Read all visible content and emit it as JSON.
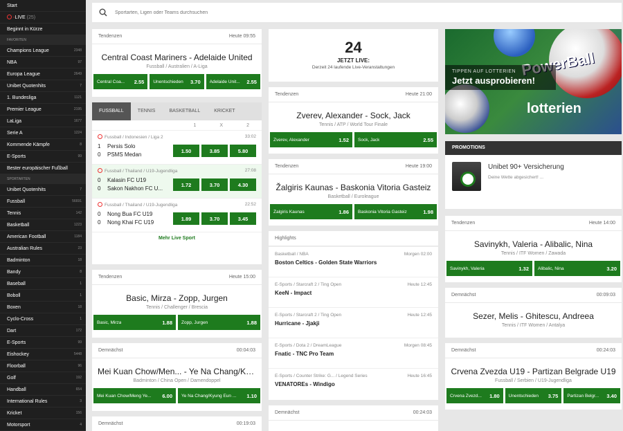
{
  "sidebar": {
    "top": [
      {
        "label": "Start"
      },
      {
        "label": "LIVE",
        "count": "(25)"
      },
      {
        "label": "Beginnt in Kürze"
      }
    ],
    "favoriten_title": "FAVORITEN",
    "favoriten": [
      {
        "label": "Champions League",
        "count": "2348"
      },
      {
        "label": "NBA",
        "count": "97"
      },
      {
        "label": "Europa League",
        "count": "2649"
      },
      {
        "label": "Unibet Quotenhits",
        "count": "7"
      },
      {
        "label": "1. Bundesliga",
        "count": "1121"
      },
      {
        "label": "Premier League",
        "count": "2195"
      },
      {
        "label": "LaLiga",
        "count": "1677"
      },
      {
        "label": "Serie A",
        "count": "1224"
      },
      {
        "label": "Kommende Kämpfe",
        "count": "8"
      },
      {
        "label": "E-Sports",
        "count": "99"
      },
      {
        "label": "Bester europäischer Fußball",
        "count": ""
      }
    ],
    "sportarten_title": "SPORTARTEN",
    "sportarten": [
      {
        "label": "Unibet Quotenhits",
        "count": "7"
      },
      {
        "label": "Fussball",
        "count": "56691"
      },
      {
        "label": "Tennis",
        "count": "142"
      },
      {
        "label": "Basketball",
        "count": "1223"
      },
      {
        "label": "American Football",
        "count": "1184"
      },
      {
        "label": "Australian Rules",
        "count": "23"
      },
      {
        "label": "Badminton",
        "count": "18"
      },
      {
        "label": "Bandy",
        "count": "8"
      },
      {
        "label": "Baseball",
        "count": "1"
      },
      {
        "label": "Boboll",
        "count": "1"
      },
      {
        "label": "Boxen",
        "count": "18"
      },
      {
        "label": "Cyclo-Cross",
        "count": "1"
      },
      {
        "label": "Dart",
        "count": "172"
      },
      {
        "label": "E-Sports",
        "count": "99"
      },
      {
        "label": "Eishockey",
        "count": "5448"
      },
      {
        "label": "Floorball",
        "count": "96"
      },
      {
        "label": "Golf",
        "count": "192"
      },
      {
        "label": "Handball",
        "count": "654"
      },
      {
        "label": "International Rules",
        "count": "3"
      },
      {
        "label": "Kricket",
        "count": "156"
      },
      {
        "label": "Motorsport",
        "count": "4"
      }
    ]
  },
  "search": {
    "placeholder": "Sportarten, Ligen oder Teams durchsuchen"
  },
  "col1": {
    "featured": {
      "header": "Tendenzen",
      "time": "Heute 09:55",
      "title": "Central Coast Mariners - Adelaide United",
      "sub": "Fussball / Australien / A-Liga",
      "odds": [
        {
          "label": "Central Coa...",
          "value": "2.55"
        },
        {
          "label": "Unentschieden",
          "value": "3.70"
        },
        {
          "label": "Adelaide Unit...",
          "value": "2.55"
        }
      ]
    },
    "live": {
      "tabs": [
        "FUSSBALL",
        "TENNIS",
        "BASKETBALL",
        "KRICKET"
      ],
      "cols": [
        "1",
        "X",
        "2"
      ],
      "items": [
        {
          "league": "Fussball / Indonesien / Liga 2",
          "time": "33:02",
          "s1": "1",
          "t1": "Persis Solo",
          "s2": "0",
          "t2": "PSMS Medan",
          "o": [
            "1.50",
            "3.85",
            "5.80"
          ]
        },
        {
          "league": "Fussball / Thailand / U19-Jugendliga",
          "time": "27:08",
          "s1": "0",
          "t1": "Kalasin FC U19",
          "s2": "0",
          "t2": "Sakon Nakhon FC U...",
          "o": [
            "1.72",
            "3.70",
            "4.30"
          ]
        },
        {
          "league": "Fussball / Thailand / U19-Jugendliga",
          "time": "22:52",
          "s1": "0",
          "t1": "Nong Bua FC U19",
          "s2": "0",
          "t2": "Nong Khai FC U19",
          "o": [
            "1.89",
            "3.70",
            "3.45"
          ]
        }
      ],
      "more": "Mehr Live Sport"
    },
    "m2": {
      "header": "Tendenzen",
      "time": "Heute 15:00",
      "title": "Basic, Mirza - Zopp, Jurgen",
      "sub": "Tennis / Challenger / Brescia",
      "odds": [
        {
          "label": "Basic, Mirza",
          "value": "1.88"
        },
        {
          "label": "Zopp, Jurgen",
          "value": "1.88"
        }
      ]
    },
    "m3": {
      "header": "Demnächst",
      "time": "00:04:03",
      "title": "Mei Kuan Chow/Men... - Ye Na Chang/Kyun...",
      "sub": "Badminton / China Open / Damendoppel",
      "odds": [
        {
          "label": "Mei Kuan Chow/Meng Ye...",
          "value": "6.00"
        },
        {
          "label": "Ye Na Chang/Kyung Eun ...",
          "value": "1.10"
        }
      ]
    },
    "m4": {
      "header": "Demnächst",
      "time": "00:19:03"
    }
  },
  "col2": {
    "live": {
      "num": "24",
      "label": "JETZT LIVE:",
      "sub": "Derzeit 24 laufende Live-Veranstaltungen"
    },
    "m1": {
      "header": "Tendenzen",
      "time": "Heute 21:00",
      "title": "Zverev, Alexander - Sock, Jack",
      "sub": "Tennis / ATP / World Tour Finale",
      "odds": [
        {
          "label": "Zverev, Alexander",
          "value": "1.52"
        },
        {
          "label": "Sock, Jack",
          "value": "2.55"
        }
      ]
    },
    "m2": {
      "header": "Tendenzen",
      "time": "Heute 19:00",
      "title": "Žalgiris Kaunas - Baskonia Vitoria Gasteiz",
      "sub": "Basketball / Euroleague",
      "odds": [
        {
          "label": "Žalgiris Kaunas",
          "value": "1.86"
        },
        {
          "label": "Baskonia Vitoria Gasteiz",
          "value": "1.98"
        }
      ]
    },
    "highlights": {
      "header": "Highlights",
      "items": [
        {
          "meta": "Basketball / NBA",
          "time": "Morgen 02:00",
          "title": "Boston Celtics - Golden State Warriors"
        },
        {
          "meta": "E-Sports / Starcraft 2 / Ting Open",
          "time": "Heute 12:45",
          "title": "KeeN - Impact"
        },
        {
          "meta": "E-Sports / Starcraft 2 / Ting Open",
          "time": "Heute 12:45",
          "title": "Hurricane - Jjakji"
        },
        {
          "meta": "E-Sports / Dota 2 / DreamLeague",
          "time": "Morgen 08:45",
          "title": "Fnatic - TNC Pro Team"
        },
        {
          "meta": "E-Sports / Counter Strike: G... / Legend Series",
          "time": "Heute 16:45",
          "title": "VENATOREs - Windigo"
        }
      ]
    },
    "m3": {
      "header": "Demnächst",
      "time": "00:24:03"
    }
  },
  "col3": {
    "banner": {
      "kicker": "TIPPEN AUF LOTTERIEN",
      "title": "Jetzt ausprobieren!",
      "logo": "lotterien",
      "pb": "PowerBall"
    },
    "promos": {
      "title": "PROMOTIONS",
      "item_title": "Unibet 90+ Versicherung",
      "item_sub": "Deine Wette abgesichert! ..."
    },
    "m1": {
      "header": "Tendenzen",
      "time": "Heute 14:00",
      "title": "Savinykh, Valeria - Alibalic, Nina",
      "sub": "Tennis / ITF Women / Zawada",
      "odds": [
        {
          "label": "Savinykh, Valeria",
          "value": "1.32"
        },
        {
          "label": "Alibalic, Nina",
          "value": "3.20"
        }
      ]
    },
    "m2": {
      "header": "Demnächst",
      "time": "00:09:03",
      "title": "Sezer, Melis - Ghitescu, Andreea",
      "sub": "Tennis / ITF Women / Antalya"
    },
    "m3": {
      "header": "Demnächst",
      "time": "00:24:03",
      "title": "Crvena Zvezda U19 - Partizan Belgrade U19",
      "sub": "Fussball / Serbien / U19-Jugendliga",
      "odds": [
        {
          "label": "Crvena Zvezd...",
          "value": "1.80"
        },
        {
          "label": "Unentschieden",
          "value": "3.75"
        },
        {
          "label": "Partizan Belgr...",
          "value": "3.40"
        }
      ]
    }
  }
}
